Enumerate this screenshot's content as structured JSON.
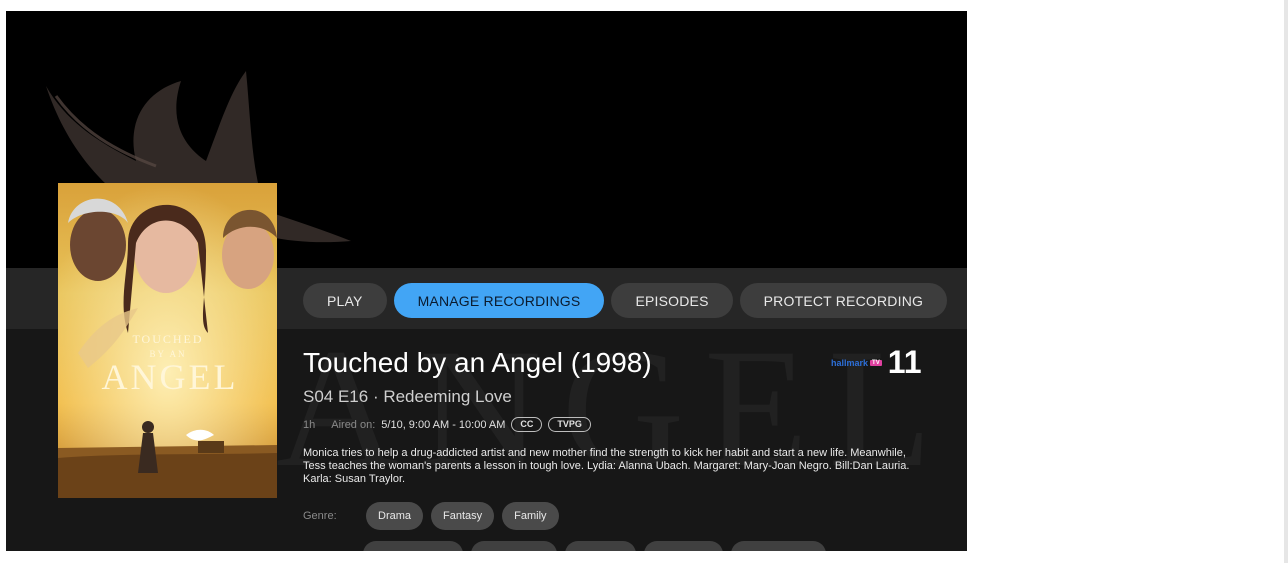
{
  "actions": [
    {
      "label": "PLAY"
    },
    {
      "label": "MANAGE RECORDINGS"
    },
    {
      "label": "EPISODES"
    },
    {
      "label": "PROTECT RECORDING"
    }
  ],
  "program": {
    "title": "Touched by an Angel (1998)",
    "episode": "S04 E16 · Redeeming Love",
    "duration": "1h",
    "aired_label": "Aired on:",
    "aired_value": "5/10, 9:00 AM - 10:00 AM",
    "badges": [
      "CC",
      "TVPG"
    ],
    "description": "Monica tries to help a drug-addicted artist and new mother find the strength to kick her habit and start a new life. Meanwhile, Tess teaches the woman's parents a lesson in tough love. Lydia: Alanna Ubach. Margaret: Mary-Joan Negro. Bill:Dan Lauria. Karla: Susan Traylor."
  },
  "genre": {
    "label": "Genre:",
    "chips": [
      "Drama",
      "Fantasy",
      "Family"
    ]
  },
  "channel": {
    "logo_text": "hallmark",
    "logo_badge": "TV",
    "number": "11"
  },
  "poster": {
    "title_small": "TOUCHED",
    "title_by": "BY AN",
    "title_large": "ANGEL"
  },
  "background_art": {
    "watermark": "ANGEL"
  },
  "colors": {
    "accent": "#42a5f5",
    "button": "#3d3d3d",
    "panel": "#171717"
  }
}
